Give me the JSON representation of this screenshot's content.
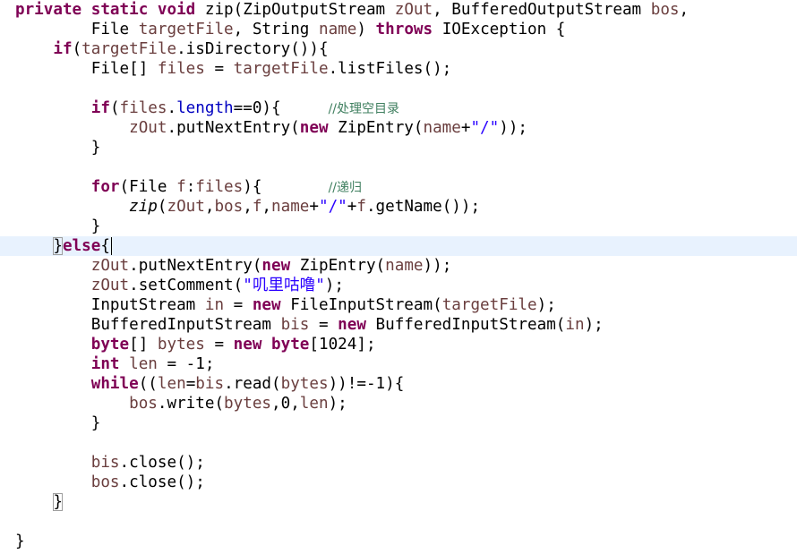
{
  "editor": {
    "language": "java",
    "current_line": 13,
    "lines": [
      [
        [
          "kw",
          "private"
        ],
        [
          "pl",
          " "
        ],
        [
          "kw",
          "static"
        ],
        [
          "pl",
          " "
        ],
        [
          "kw",
          "void"
        ],
        [
          "pl",
          " zip(ZipOutputStream "
        ],
        [
          "var",
          "zOut"
        ],
        [
          "pl",
          ", BufferedOutputStream "
        ],
        [
          "var",
          "bos"
        ],
        [
          "pl",
          ","
        ]
      ],
      [
        [
          "pl",
          "        File "
        ],
        [
          "var",
          "targetFile"
        ],
        [
          "pl",
          ", String "
        ],
        [
          "var",
          "name"
        ],
        [
          "pl",
          ") "
        ],
        [
          "kw",
          "throws"
        ],
        [
          "pl",
          " IOException {"
        ]
      ],
      [
        [
          "pl",
          "    "
        ],
        [
          "kw",
          "if"
        ],
        [
          "pl",
          "("
        ],
        [
          "var",
          "targetFile"
        ],
        [
          "pl",
          ".isDirectory()){"
        ]
      ],
      [
        [
          "pl",
          "        File[] "
        ],
        [
          "var",
          "files"
        ],
        [
          "pl",
          " = "
        ],
        [
          "var",
          "targetFile"
        ],
        [
          "pl",
          ".listFiles();"
        ]
      ],
      [],
      [
        [
          "pl",
          "        "
        ],
        [
          "kw",
          "if"
        ],
        [
          "pl",
          "("
        ],
        [
          "var",
          "files"
        ],
        [
          "pl",
          "."
        ],
        [
          "field",
          "length"
        ],
        [
          "pl",
          "==0){     "
        ],
        [
          "cmt",
          "//处理空目录"
        ]
      ],
      [
        [
          "pl",
          "            "
        ],
        [
          "var",
          "zOut"
        ],
        [
          "pl",
          ".putNextEntry("
        ],
        [
          "kw",
          "new"
        ],
        [
          "pl",
          " ZipEntry("
        ],
        [
          "var",
          "name"
        ],
        [
          "pl",
          "+"
        ],
        [
          "str",
          "\"/\""
        ],
        [
          "pl",
          "));"
        ]
      ],
      [
        [
          "pl",
          "        }"
        ]
      ],
      [],
      [
        [
          "pl",
          "        "
        ],
        [
          "kw",
          "for"
        ],
        [
          "pl",
          "(File "
        ],
        [
          "var",
          "f"
        ],
        [
          "pl",
          ":"
        ],
        [
          "var",
          "files"
        ],
        [
          "pl",
          "){       "
        ],
        [
          "cmt",
          "//递归"
        ]
      ],
      [
        [
          "pl",
          "            "
        ],
        [
          "it",
          "zip"
        ],
        [
          "pl",
          "("
        ],
        [
          "var",
          "zOut"
        ],
        [
          "pl",
          ","
        ],
        [
          "var",
          "bos"
        ],
        [
          "pl",
          ","
        ],
        [
          "var",
          "f"
        ],
        [
          "pl",
          ","
        ],
        [
          "var",
          "name"
        ],
        [
          "pl",
          "+"
        ],
        [
          "str",
          "\"/\""
        ],
        [
          "pl",
          "+"
        ],
        [
          "var",
          "f"
        ],
        [
          "pl",
          ".getName());"
        ]
      ],
      [
        [
          "pl",
          "        }"
        ]
      ],
      [
        [
          "pl",
          "    "
        ],
        [
          "box",
          "}"
        ],
        [
          "kw",
          "else"
        ],
        [
          "pl",
          "{"
        ],
        [
          "caret",
          ""
        ]
      ],
      [
        [
          "pl",
          "        "
        ],
        [
          "var",
          "zOut"
        ],
        [
          "pl",
          ".putNextEntry("
        ],
        [
          "kw",
          "new"
        ],
        [
          "pl",
          " ZipEntry("
        ],
        [
          "var",
          "name"
        ],
        [
          "pl",
          "));"
        ]
      ],
      [
        [
          "pl",
          "        "
        ],
        [
          "var",
          "zOut"
        ],
        [
          "pl",
          ".setComment("
        ],
        [
          "str",
          "\"叽里咕噜\""
        ],
        [
          "pl",
          ");"
        ]
      ],
      [
        [
          "pl",
          "        InputStream "
        ],
        [
          "var",
          "in"
        ],
        [
          "pl",
          " = "
        ],
        [
          "kw",
          "new"
        ],
        [
          "pl",
          " FileInputStream("
        ],
        [
          "var",
          "targetFile"
        ],
        [
          "pl",
          ");"
        ]
      ],
      [
        [
          "pl",
          "        BufferedInputStream "
        ],
        [
          "var",
          "bis"
        ],
        [
          "pl",
          " = "
        ],
        [
          "kw",
          "new"
        ],
        [
          "pl",
          " BufferedInputStream("
        ],
        [
          "var",
          "in"
        ],
        [
          "pl",
          ");"
        ]
      ],
      [
        [
          "pl",
          "        "
        ],
        [
          "kw",
          "byte"
        ],
        [
          "pl",
          "[] "
        ],
        [
          "var",
          "bytes"
        ],
        [
          "pl",
          " = "
        ],
        [
          "kw",
          "new"
        ],
        [
          "pl",
          " "
        ],
        [
          "kw",
          "byte"
        ],
        [
          "pl",
          "[1024];"
        ]
      ],
      [
        [
          "pl",
          "        "
        ],
        [
          "kw",
          "int"
        ],
        [
          "pl",
          " "
        ],
        [
          "var",
          "len"
        ],
        [
          "pl",
          " = -1;"
        ]
      ],
      [
        [
          "pl",
          "        "
        ],
        [
          "kw",
          "while"
        ],
        [
          "pl",
          "(("
        ],
        [
          "var",
          "len"
        ],
        [
          "pl",
          "="
        ],
        [
          "var",
          "bis"
        ],
        [
          "pl",
          ".read("
        ],
        [
          "var",
          "bytes"
        ],
        [
          "pl",
          "))!=-1){"
        ]
      ],
      [
        [
          "pl",
          "            "
        ],
        [
          "var",
          "bos"
        ],
        [
          "pl",
          ".write("
        ],
        [
          "var",
          "bytes"
        ],
        [
          "pl",
          ",0,"
        ],
        [
          "var",
          "len"
        ],
        [
          "pl",
          ");"
        ]
      ],
      [
        [
          "pl",
          "        }"
        ]
      ],
      [],
      [
        [
          "pl",
          "        "
        ],
        [
          "var",
          "bis"
        ],
        [
          "pl",
          ".close();"
        ]
      ],
      [
        [
          "pl",
          "        "
        ],
        [
          "var",
          "bos"
        ],
        [
          "pl",
          ".close();"
        ]
      ],
      [
        [
          "pl",
          "    "
        ],
        [
          "box",
          "}"
        ]
      ],
      [],
      [
        [
          "pl",
          "}"
        ]
      ]
    ]
  },
  "colors": {
    "keyword": "#7f0055",
    "local_variable": "#6a3e3e",
    "field": "#0000c0",
    "string": "#2a00ff",
    "comment": "#3f7f5f",
    "current_line_highlight": "#e8f2fe",
    "background": "#ffffff"
  }
}
